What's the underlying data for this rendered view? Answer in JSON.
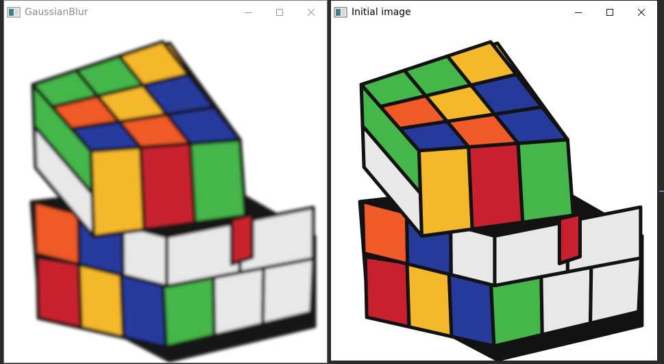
{
  "windows": {
    "blur": {
      "title": "GaussianBlur",
      "icon": "app-window-icon",
      "controls": [
        "minimize-icon",
        "maximize-icon",
        "close-icon"
      ]
    },
    "initial": {
      "title": "Initial image",
      "icon": "app-window-icon",
      "controls": [
        "minimize-icon",
        "maximize-icon",
        "close-icon"
      ]
    }
  },
  "image": {
    "subject": "rubiks-cube",
    "colors": {
      "green": "#45b649",
      "orange": "#f05a28",
      "red": "#c8202f",
      "blue": "#253a9b",
      "yellow": "#f4b82a",
      "white": "#e8e8e8",
      "black": "#121212"
    }
  }
}
